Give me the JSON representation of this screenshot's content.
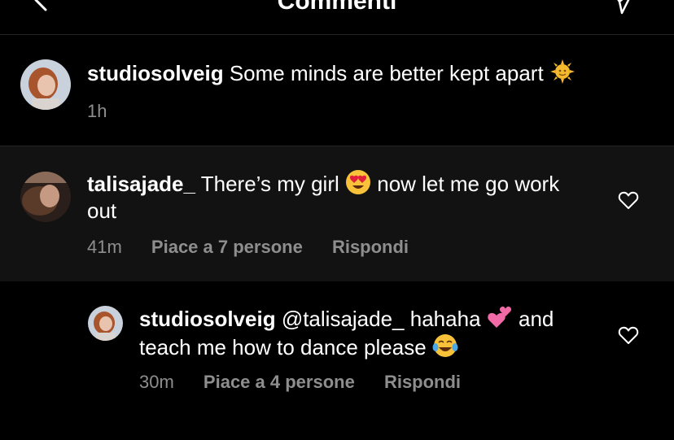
{
  "header": {
    "title": "Commenti",
    "back_icon": "chevron-left-icon",
    "send_icon": "paper-plane-icon"
  },
  "caption": {
    "username": "studiosolveig",
    "text": "Some minds are better kept apart",
    "emoji": "sun-face-emoji",
    "time": "1h"
  },
  "comments": [
    {
      "username": "talisajade_",
      "text_before": "There’s my girl",
      "emoji": "heart-eyes-emoji",
      "text_after": "now let me go work out",
      "time": "41m",
      "likes": "Piace a 7 persone",
      "reply": "Rispondi"
    },
    {
      "username": "studiosolveig",
      "mention": "@talisajade_",
      "text_before": "hahaha",
      "emoji1": "two-hearts-emoji",
      "text_after": "and teach me how to dance please",
      "emoji2": "tears-of-joy-emoji",
      "time": "30m",
      "likes": "Piace a 4 persone",
      "reply": "Rispondi"
    }
  ],
  "colors": {
    "background": "#000000",
    "highlight_row": "#121212",
    "meta_text": "#8e8e8e",
    "divider": "#262626"
  }
}
